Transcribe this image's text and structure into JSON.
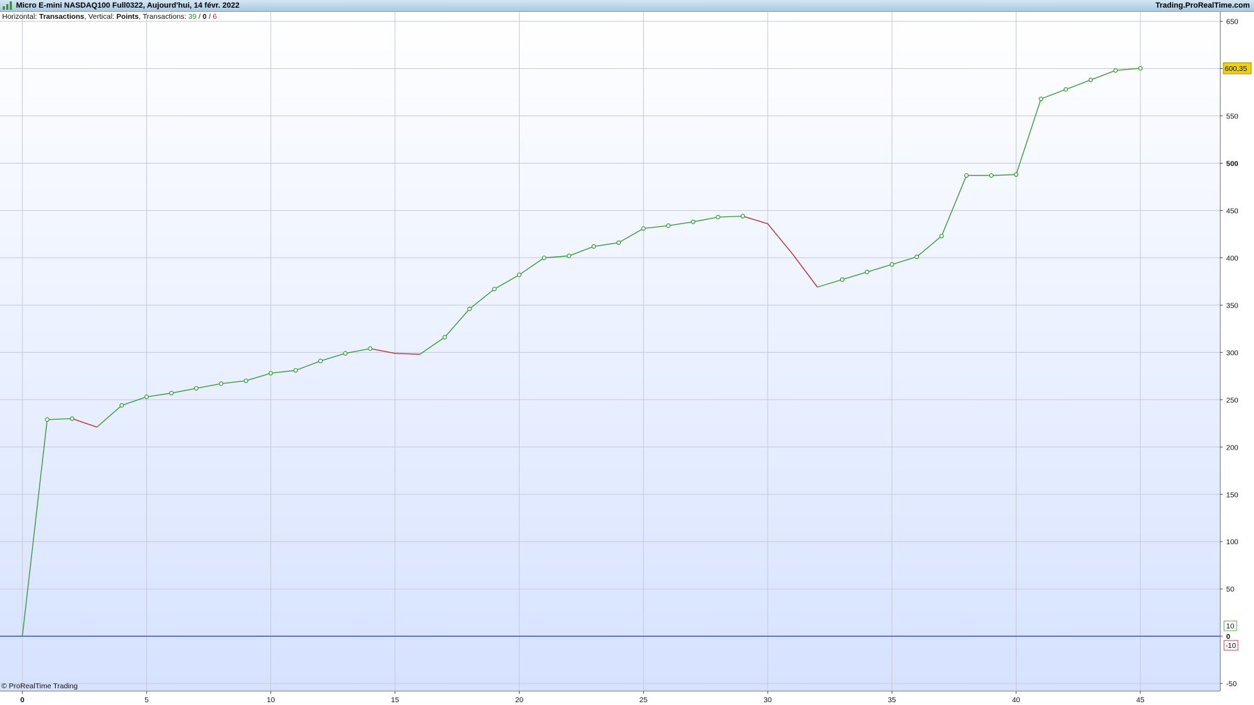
{
  "window": {
    "title": "Micro E-mini NASDAQ100 Full0322, Aujourd'hui, 14 févr. 2022",
    "brand": "Trading.ProRealTime.com"
  },
  "info": {
    "horizontal_label": "Horizontal:",
    "horizontal_value": "Transactions",
    "vertical_label": "Vertical:",
    "vertical_value": "Points",
    "transactions_label": "Transactions:",
    "wins": "39",
    "neutral": "0",
    "losses": "6",
    "sep": "/"
  },
  "footer": {
    "copyright": "© ProRealTime Trading"
  },
  "colors": {
    "up": "#3a9a3a",
    "down": "#c0282d",
    "zero_line": "#4a64c8",
    "grid": "#c6cbd6",
    "last_badge_bg": "#f2d200"
  },
  "chart_data": {
    "type": "line",
    "x": [
      0,
      1,
      2,
      3,
      4,
      5,
      6,
      7,
      8,
      9,
      10,
      11,
      12,
      13,
      14,
      15,
      16,
      17,
      18,
      19,
      20,
      21,
      22,
      23,
      24,
      25,
      26,
      27,
      28,
      29,
      30,
      31,
      32,
      33,
      34,
      35,
      36,
      37,
      38,
      39,
      40,
      41,
      42,
      43,
      44,
      45
    ],
    "values": [
      0,
      229,
      230,
      221,
      244,
      253,
      257,
      262,
      267,
      270,
      278,
      281,
      291,
      299,
      304,
      299,
      298,
      316,
      346,
      367,
      382,
      400,
      402,
      412,
      416,
      431,
      434,
      438,
      443,
      444,
      436,
      404,
      369,
      377,
      385,
      393,
      401,
      423,
      487,
      487,
      488,
      568,
      578,
      588,
      598,
      600.35
    ],
    "xlim": [
      -0.9,
      48.2
    ],
    "ylim": [
      -58,
      660
    ],
    "x_ticks": [
      0,
      5,
      10,
      15,
      20,
      25,
      30,
      35,
      40,
      45
    ],
    "y_ticks": [
      -50,
      0,
      50,
      100,
      150,
      200,
      250,
      300,
      350,
      400,
      450,
      500,
      550,
      600,
      650
    ],
    "y_ticks_bold": [
      0,
      500
    ],
    "last_value_label": "600,35",
    "zero_badges": {
      "above": "10",
      "below": "-10"
    },
    "grid": true
  }
}
